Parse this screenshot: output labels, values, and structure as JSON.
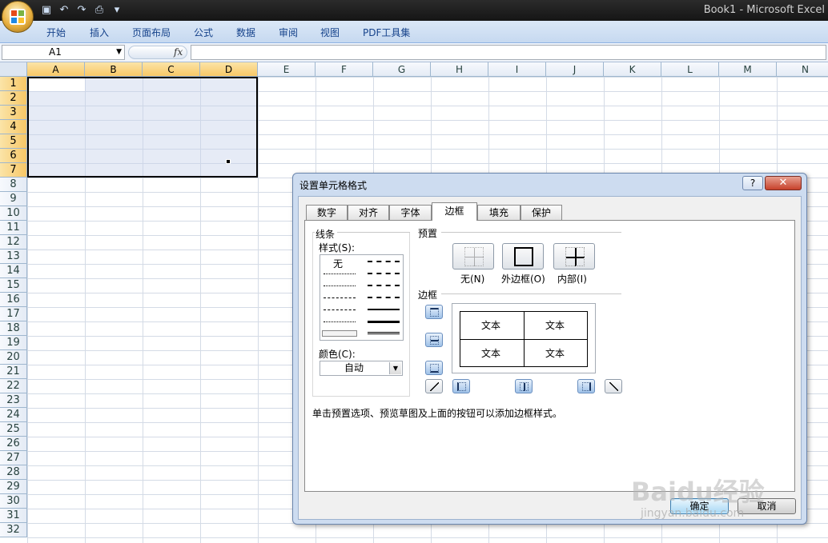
{
  "window": {
    "title": "Book1 - Microsoft Excel"
  },
  "quick_access": {
    "icons": [
      "save-icon",
      "undo-icon",
      "redo-icon",
      "print-preview-icon",
      "customize-icon"
    ]
  },
  "ribbon": {
    "tabs": [
      "开始",
      "插入",
      "页面布局",
      "公式",
      "数据",
      "审阅",
      "视图",
      "PDF工具集"
    ]
  },
  "formula_bar": {
    "name_box": "A1",
    "fx": "fx",
    "formula": ""
  },
  "sheet": {
    "columns": [
      "A",
      "B",
      "C",
      "D",
      "E",
      "F",
      "G",
      "H",
      "I",
      "J",
      "K",
      "L",
      "M",
      "N"
    ],
    "rows": [
      "1",
      "2",
      "3",
      "4",
      "5",
      "6",
      "7",
      "8",
      "9",
      "10",
      "11",
      "12",
      "13",
      "14",
      "15",
      "16",
      "17",
      "18",
      "19",
      "20",
      "21",
      "22",
      "23",
      "24",
      "25",
      "26",
      "27",
      "28",
      "29",
      "30",
      "31",
      "32"
    ],
    "selected_range": "A1:D7"
  },
  "dialog": {
    "title": "设置单元格格式",
    "help": "?",
    "close": "✕",
    "tabs": [
      "数字",
      "对齐",
      "字体",
      "边框",
      "填充",
      "保护"
    ],
    "active_tab": "边框",
    "line_group": "线条",
    "style_label": "样式(S):",
    "style_none": "无",
    "color_label": "颜色(C):",
    "color_value": "自动",
    "preset_group": "预置",
    "presets": [
      "无(N)",
      "外边框(O)",
      "内部(I)"
    ],
    "border_group": "边框",
    "preview_text": [
      "文本",
      "文本",
      "文本",
      "文本"
    ],
    "hint": "单击预置选项、预览草图及上面的按钮可以添加边框样式。",
    "ok": "确定",
    "cancel": "取消"
  },
  "watermark": {
    "brand": "Baidu经验",
    "url": "jingyan.baidu.com"
  }
}
